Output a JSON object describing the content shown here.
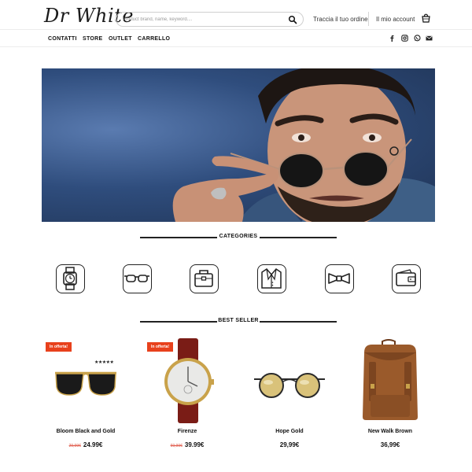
{
  "header": {
    "logo_text": "Dr White",
    "search_placeholder": "Product brand, name, keyword....",
    "track_order": "Traccia il tuo ordine",
    "account": "Il mio account"
  },
  "nav": {
    "items": [
      "CONTATTI",
      "STORE",
      "OUTLET",
      "CARRELLO"
    ],
    "social_icons": [
      "facebook-icon",
      "instagram-icon",
      "whatsapp-icon",
      "email-icon"
    ]
  },
  "categories": {
    "title": "CATEGORIES",
    "icons": [
      "watch-icon",
      "sunglasses-icon",
      "bag-icon",
      "jacket-icon",
      "bowtie-icon",
      "wallet-icon"
    ]
  },
  "best_seller": {
    "title": "BEST SELLER",
    "products": [
      {
        "name": "Bloom Black and Gold",
        "old_price": "29,99€",
        "price": "24.99€",
        "badge": "In offerta!",
        "rating": "★★★★★"
      },
      {
        "name": "Firenze",
        "old_price": "69,99€",
        "price": "39.99€",
        "badge": "In offerta!"
      },
      {
        "name": "Hope Gold",
        "price": "29,99€"
      },
      {
        "name": "New Walk Brown",
        "price": "36,99€"
      }
    ]
  },
  "colors": {
    "badge": "#e8411c",
    "old_price": "#e05a4a",
    "hero_bg": "#2f4d7d"
  }
}
